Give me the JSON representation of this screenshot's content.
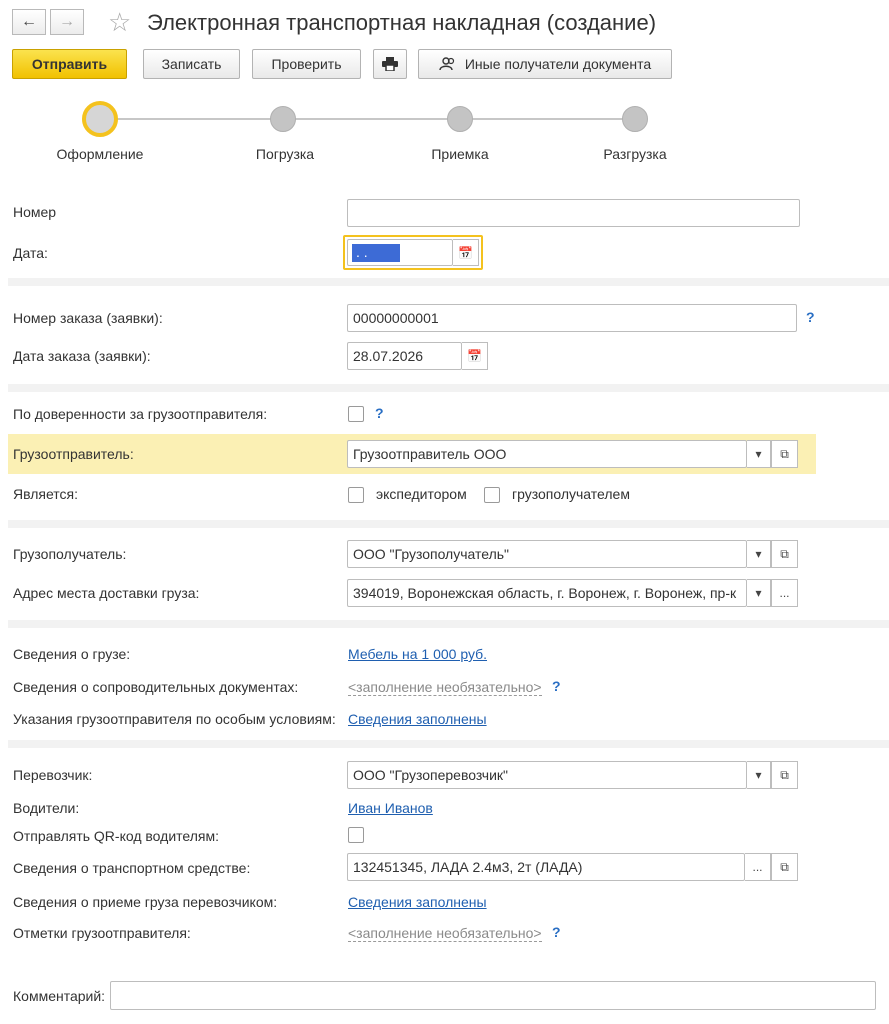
{
  "header": {
    "title": "Электронная транспортная накладная (создание)",
    "back_icon": "arrow-left-icon",
    "forward_icon": "arrow-right-icon",
    "favorite_icon": "star-icon"
  },
  "toolbar": {
    "send_label": "Отправить",
    "save_label": "Записать",
    "check_label": "Проверить",
    "print_icon": "printer-icon",
    "recipients_label": "Иные получатели документа"
  },
  "steps": [
    {
      "label": "Оформление",
      "active": true
    },
    {
      "label": "Погрузка",
      "active": false
    },
    {
      "label": "Приемка",
      "active": false
    },
    {
      "label": "Разгрузка",
      "active": false
    }
  ],
  "form": {
    "number": {
      "label": "Номер",
      "value": ""
    },
    "date": {
      "label": "Дата:",
      "value": ". ."
    },
    "order_number": {
      "label": "Номер заказа (заявки):",
      "value": "00000000001",
      "help": "?"
    },
    "order_date": {
      "label": "Дата заказа (заявки):",
      "value": "28.07.2026"
    },
    "by_proxy": {
      "label": "По доверенности за грузоотправителя:",
      "checked": false,
      "help": "?"
    },
    "shipper": {
      "label": "Грузоотправитель:",
      "value": "Грузоотправитель ООО"
    },
    "is": {
      "label": "Является:",
      "option1": "экспедитором",
      "option2": "грузополучателем"
    },
    "consignee": {
      "label": "Грузополучатель:",
      "value": "ООО \"Грузополучатель\""
    },
    "delivery_address": {
      "label": "Адрес места доставки груза:",
      "value": "394019, Воронежская область, г. Воронеж, г. Воронеж, пр-к"
    },
    "cargo_info": {
      "label": "Сведения о грузе:",
      "value": "Мебель на 1 000 руб."
    },
    "accompanying_docs": {
      "label": "Сведения о сопроводительных документах:",
      "value": "<заполнение необязательно>",
      "help": "?"
    },
    "special_conditions": {
      "label": "Указания грузоотправителя по особым условиям:",
      "value": "Сведения заполнены"
    },
    "carrier": {
      "label": "Перевозчик:",
      "value": "ООО \"Грузоперевозчик\""
    },
    "drivers": {
      "label": "Водители:",
      "value": "Иван Иванов"
    },
    "send_qr": {
      "label": "Отправлять QR-код водителям:",
      "checked": false
    },
    "vehicle": {
      "label": "Сведения о транспортном средстве:",
      "value": "132451345, ЛАДА  2.4м3, 2т (ЛАДА)"
    },
    "carrier_acceptance": {
      "label": "Сведения о приеме груза перевозчиком:",
      "value": "Сведения заполнены"
    },
    "shipper_marks": {
      "label": "Отметки грузоотправителя:",
      "value": "<заполнение необязательно>",
      "help": "?"
    },
    "comment": {
      "label": "Комментарий:",
      "value": ""
    }
  },
  "colors": {
    "accent": "#f4c21e",
    "link": "#1f5fb0",
    "highlight": "#fbf0b4"
  }
}
